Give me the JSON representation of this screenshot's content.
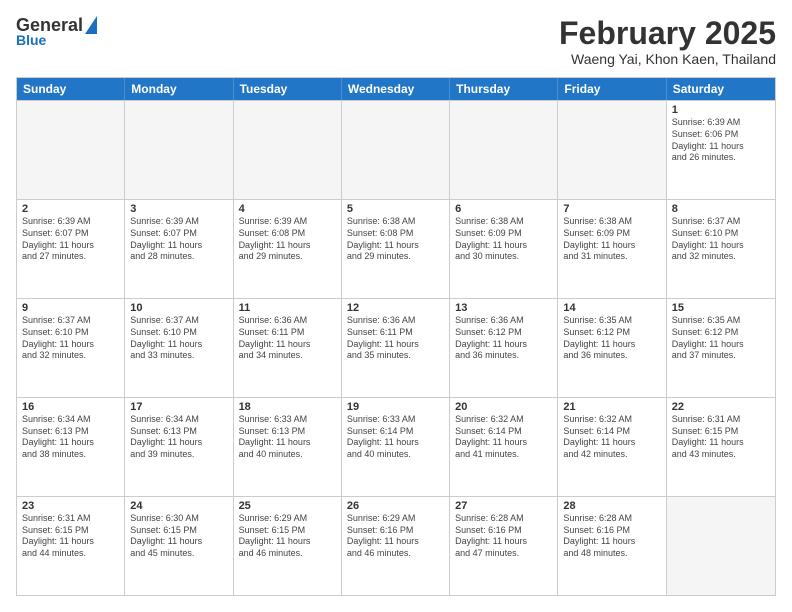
{
  "header": {
    "logo_general": "General",
    "logo_blue": "Blue",
    "month_title": "February 2025",
    "location": "Waeng Yai, Khon Kaen, Thailand"
  },
  "weekdays": [
    "Sunday",
    "Monday",
    "Tuesday",
    "Wednesday",
    "Thursday",
    "Friday",
    "Saturday"
  ],
  "weeks": [
    [
      {
        "day": "",
        "info": ""
      },
      {
        "day": "",
        "info": ""
      },
      {
        "day": "",
        "info": ""
      },
      {
        "day": "",
        "info": ""
      },
      {
        "day": "",
        "info": ""
      },
      {
        "day": "",
        "info": ""
      },
      {
        "day": "1",
        "info": "Sunrise: 6:39 AM\nSunset: 6:06 PM\nDaylight: 11 hours\nand 26 minutes."
      }
    ],
    [
      {
        "day": "2",
        "info": "Sunrise: 6:39 AM\nSunset: 6:07 PM\nDaylight: 11 hours\nand 27 minutes."
      },
      {
        "day": "3",
        "info": "Sunrise: 6:39 AM\nSunset: 6:07 PM\nDaylight: 11 hours\nand 28 minutes."
      },
      {
        "day": "4",
        "info": "Sunrise: 6:39 AM\nSunset: 6:08 PM\nDaylight: 11 hours\nand 29 minutes."
      },
      {
        "day": "5",
        "info": "Sunrise: 6:38 AM\nSunset: 6:08 PM\nDaylight: 11 hours\nand 29 minutes."
      },
      {
        "day": "6",
        "info": "Sunrise: 6:38 AM\nSunset: 6:09 PM\nDaylight: 11 hours\nand 30 minutes."
      },
      {
        "day": "7",
        "info": "Sunrise: 6:38 AM\nSunset: 6:09 PM\nDaylight: 11 hours\nand 31 minutes."
      },
      {
        "day": "8",
        "info": "Sunrise: 6:37 AM\nSunset: 6:10 PM\nDaylight: 11 hours\nand 32 minutes."
      }
    ],
    [
      {
        "day": "9",
        "info": "Sunrise: 6:37 AM\nSunset: 6:10 PM\nDaylight: 11 hours\nand 32 minutes."
      },
      {
        "day": "10",
        "info": "Sunrise: 6:37 AM\nSunset: 6:10 PM\nDaylight: 11 hours\nand 33 minutes."
      },
      {
        "day": "11",
        "info": "Sunrise: 6:36 AM\nSunset: 6:11 PM\nDaylight: 11 hours\nand 34 minutes."
      },
      {
        "day": "12",
        "info": "Sunrise: 6:36 AM\nSunset: 6:11 PM\nDaylight: 11 hours\nand 35 minutes."
      },
      {
        "day": "13",
        "info": "Sunrise: 6:36 AM\nSunset: 6:12 PM\nDaylight: 11 hours\nand 36 minutes."
      },
      {
        "day": "14",
        "info": "Sunrise: 6:35 AM\nSunset: 6:12 PM\nDaylight: 11 hours\nand 36 minutes."
      },
      {
        "day": "15",
        "info": "Sunrise: 6:35 AM\nSunset: 6:12 PM\nDaylight: 11 hours\nand 37 minutes."
      }
    ],
    [
      {
        "day": "16",
        "info": "Sunrise: 6:34 AM\nSunset: 6:13 PM\nDaylight: 11 hours\nand 38 minutes."
      },
      {
        "day": "17",
        "info": "Sunrise: 6:34 AM\nSunset: 6:13 PM\nDaylight: 11 hours\nand 39 minutes."
      },
      {
        "day": "18",
        "info": "Sunrise: 6:33 AM\nSunset: 6:13 PM\nDaylight: 11 hours\nand 40 minutes."
      },
      {
        "day": "19",
        "info": "Sunrise: 6:33 AM\nSunset: 6:14 PM\nDaylight: 11 hours\nand 40 minutes."
      },
      {
        "day": "20",
        "info": "Sunrise: 6:32 AM\nSunset: 6:14 PM\nDaylight: 11 hours\nand 41 minutes."
      },
      {
        "day": "21",
        "info": "Sunrise: 6:32 AM\nSunset: 6:14 PM\nDaylight: 11 hours\nand 42 minutes."
      },
      {
        "day": "22",
        "info": "Sunrise: 6:31 AM\nSunset: 6:15 PM\nDaylight: 11 hours\nand 43 minutes."
      }
    ],
    [
      {
        "day": "23",
        "info": "Sunrise: 6:31 AM\nSunset: 6:15 PM\nDaylight: 11 hours\nand 44 minutes."
      },
      {
        "day": "24",
        "info": "Sunrise: 6:30 AM\nSunset: 6:15 PM\nDaylight: 11 hours\nand 45 minutes."
      },
      {
        "day": "25",
        "info": "Sunrise: 6:29 AM\nSunset: 6:15 PM\nDaylight: 11 hours\nand 46 minutes."
      },
      {
        "day": "26",
        "info": "Sunrise: 6:29 AM\nSunset: 6:16 PM\nDaylight: 11 hours\nand 46 minutes."
      },
      {
        "day": "27",
        "info": "Sunrise: 6:28 AM\nSunset: 6:16 PM\nDaylight: 11 hours\nand 47 minutes."
      },
      {
        "day": "28",
        "info": "Sunrise: 6:28 AM\nSunset: 6:16 PM\nDaylight: 11 hours\nand 48 minutes."
      },
      {
        "day": "",
        "info": ""
      }
    ]
  ]
}
